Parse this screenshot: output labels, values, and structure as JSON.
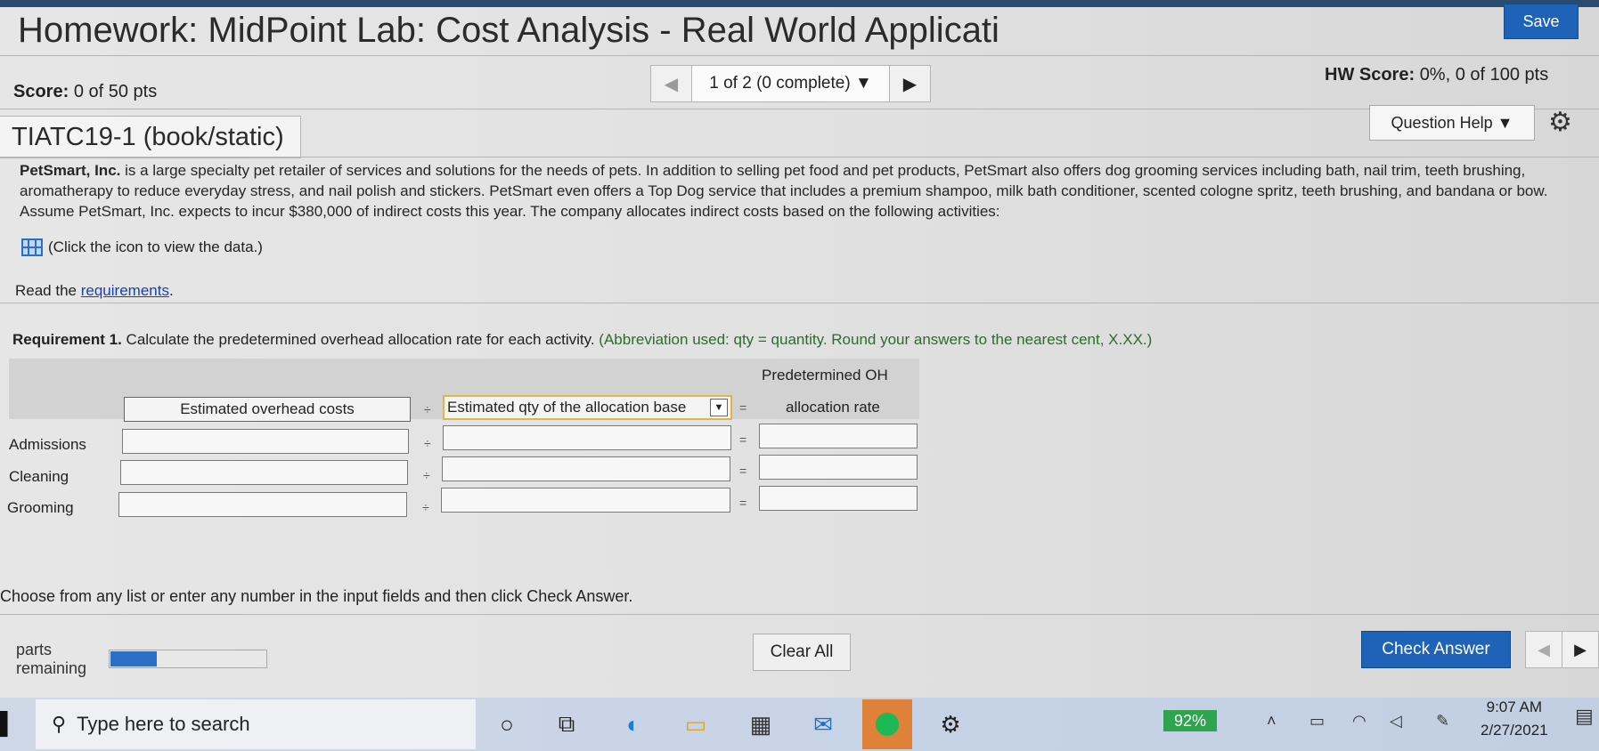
{
  "header": {
    "title": "Homework: MidPoint Lab: Cost Analysis - Real World Applicati",
    "save_label": "Save"
  },
  "scorebar": {
    "score_label": "Score:",
    "score_value": "0 of 50 pts",
    "nav_text": "1 of 2 (0 complete) ▼",
    "hw_score_label": "HW Score:",
    "hw_score_value": "0%, 0 of 100 pts"
  },
  "question": {
    "id": "TIATC19-1 (book/static)",
    "help_label": "Question Help ▼",
    "company": "PetSmart, Inc.",
    "prompt": " is a large specialty pet retailer of services and solutions for the needs of pets. In addition to selling pet food and pet products, PetSmart also offers dog grooming services including bath, nail trim, teeth brushing, aromatherapy to reduce everyday stress, and nail polish and stickers. PetSmart even offers a Top Dog service that includes a premium shampoo, milk bath conditioner, scented cologne spritz, teeth brushing, and bandana or bow. Assume PetSmart, Inc. expects to incur $380,000 of indirect costs this year. The company allocates indirect costs based on the following activities:",
    "data_link": "(Click the icon to view the data.)",
    "read_prefix": "Read the ",
    "read_link": "requirements",
    "read_suffix": "."
  },
  "requirement": {
    "label": "Requirement 1.",
    "text": " Calculate the predetermined overhead allocation rate for each activity.",
    "note": " (Abbreviation used: qty = quantity. Round your answers to the nearest cent, X.XX.)"
  },
  "table": {
    "header_predet": "Predetermined OH",
    "col_est_costs": "Estimated overhead costs",
    "col_est_qty": "Estimated qty of the allocation base",
    "col_rate": "allocation rate",
    "div_symbol": "÷",
    "eq_symbol": "=",
    "rows": [
      "Admissions",
      "Cleaning",
      "Grooming"
    ]
  },
  "footer": {
    "choose_text": "Choose from any list or enter any number in the input fields and then click Check Answer.",
    "parts_line1": "parts",
    "parts_line2": "remaining",
    "progress_fraction": 0.3,
    "clear_label": "Clear All",
    "check_label": "Check Answer"
  },
  "taskbar": {
    "search_placeholder": "Type here to search",
    "battery": "92%",
    "time": "9:07 AM",
    "date": "2/27/2021"
  }
}
